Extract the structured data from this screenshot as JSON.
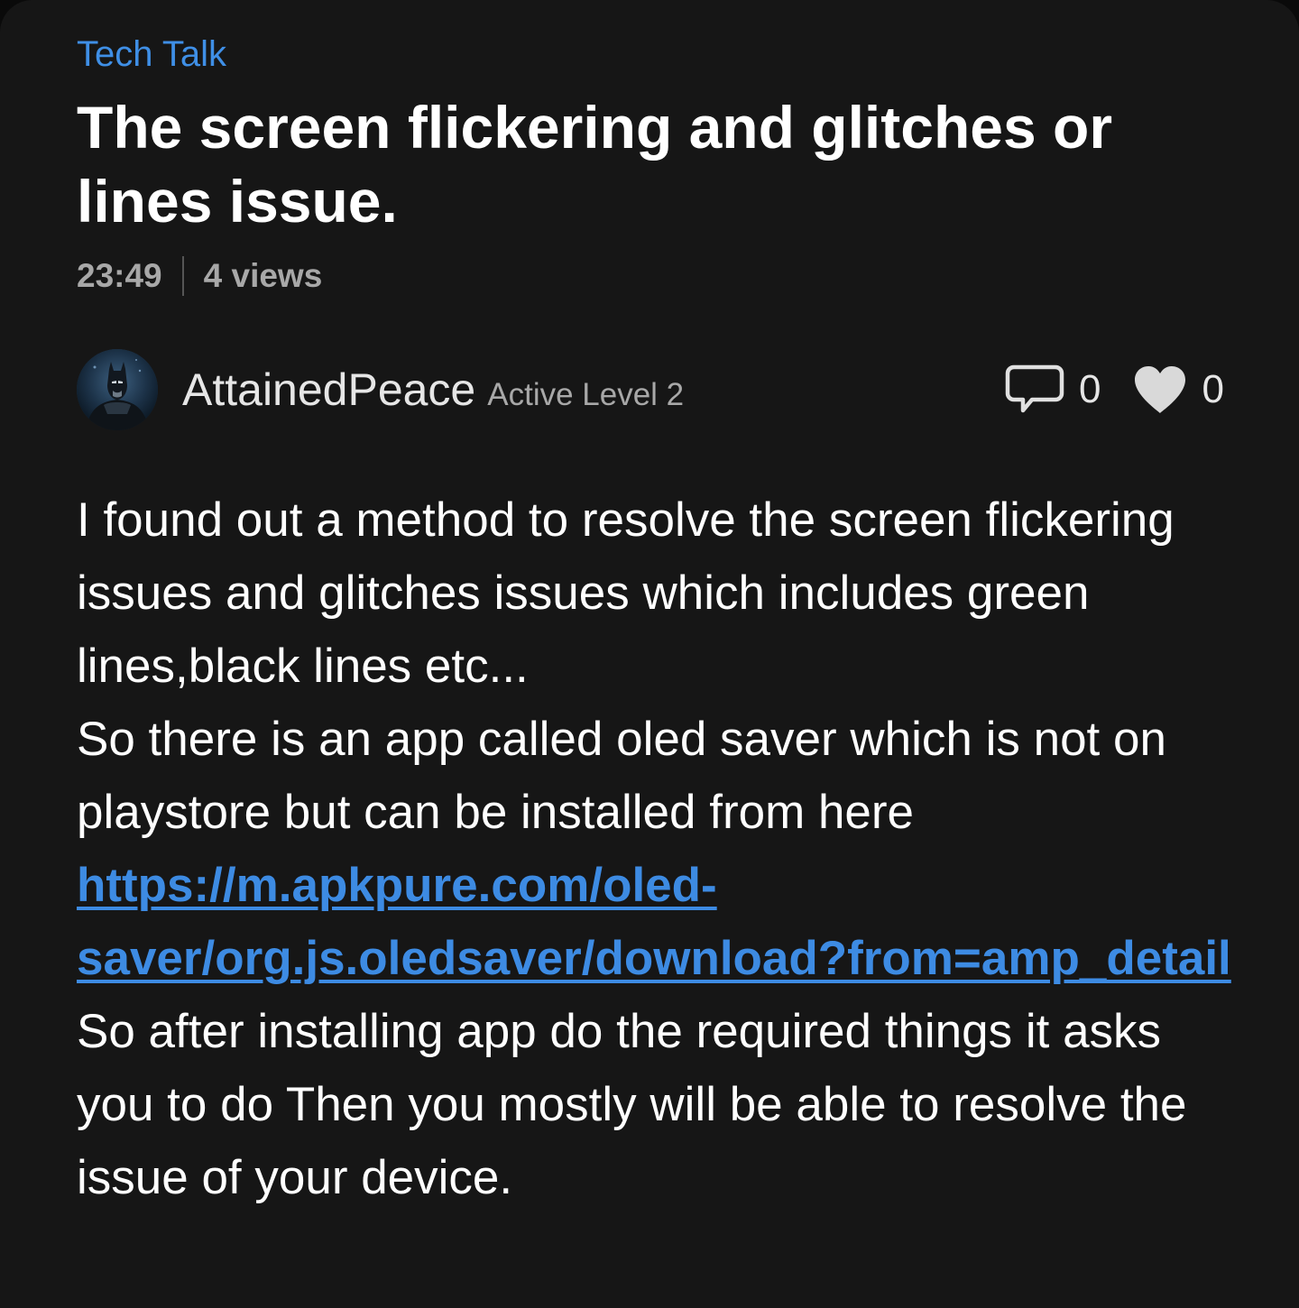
{
  "post": {
    "category": "Tech Talk",
    "title": "The screen flickering and glitches or lines issue.",
    "time": "23:49",
    "views": "4 views"
  },
  "author": {
    "name": "AttainedPeace",
    "level": "Active Level 2",
    "avatar_icon": "batman-avatar"
  },
  "stats": {
    "comments_count": "0",
    "comments_icon": "comment-bubble-icon",
    "likes_count": "0",
    "likes_icon": "heart-icon"
  },
  "body": {
    "paragraph1": "I found out a method to resolve the screen flickering issues and glitches issues which includes green lines,black lines etc...",
    "paragraph2_prefix": "So there is an app called oled saver which is not on playstore but can be installed from here ",
    "link_text": "https://m.apkpure.com/oled-saver/org.js.oledsaver/download?from=amp_detail",
    "paragraph2_suffix": " So after installing app do the required things it asks you to do Then you mostly will be able to resolve the issue of your device."
  },
  "colors": {
    "background": "#161616",
    "accent": "#3f8fe6",
    "link": "#3d8be3",
    "muted": "#a8a8a8"
  }
}
